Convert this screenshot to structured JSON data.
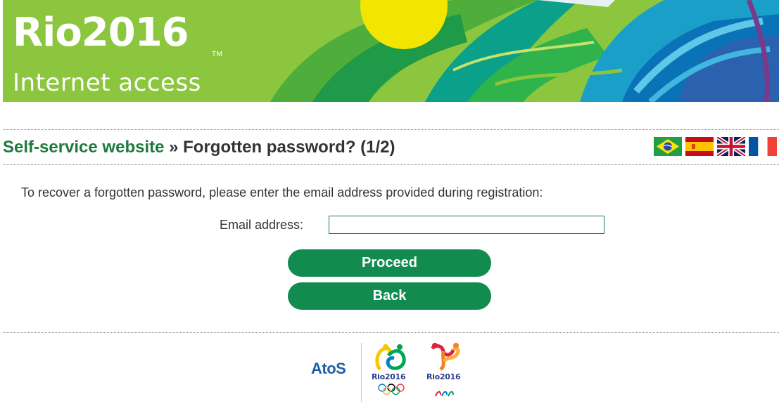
{
  "banner": {
    "logo_text": "Rio2016",
    "tm": "TM",
    "subtitle": "Internet access"
  },
  "header": {
    "breadcrumb_link": "Self-service website",
    "separator": " » ",
    "page_title": "Forgotten password? (1/2)"
  },
  "languages": [
    {
      "name": "brazil-flag-icon"
    },
    {
      "name": "spain-flag-icon"
    },
    {
      "name": "uk-flag-icon"
    },
    {
      "name": "france-flag-icon"
    }
  ],
  "form": {
    "instructions": "To recover a forgotten password, please enter the email address provided during registration:",
    "email_label": "Email address:",
    "email_value": "",
    "email_placeholder": "",
    "proceed_label": "Proceed",
    "back_label": "Back"
  },
  "footer": {
    "sponsor": "AtoS",
    "olympic_caption": "Rio2016",
    "paralympic_caption": "Rio2016"
  },
  "colors": {
    "brand_green": "#128b4e",
    "title_green": "#1d7a3d",
    "banner_green": "#8cc63f",
    "text": "#333333"
  }
}
